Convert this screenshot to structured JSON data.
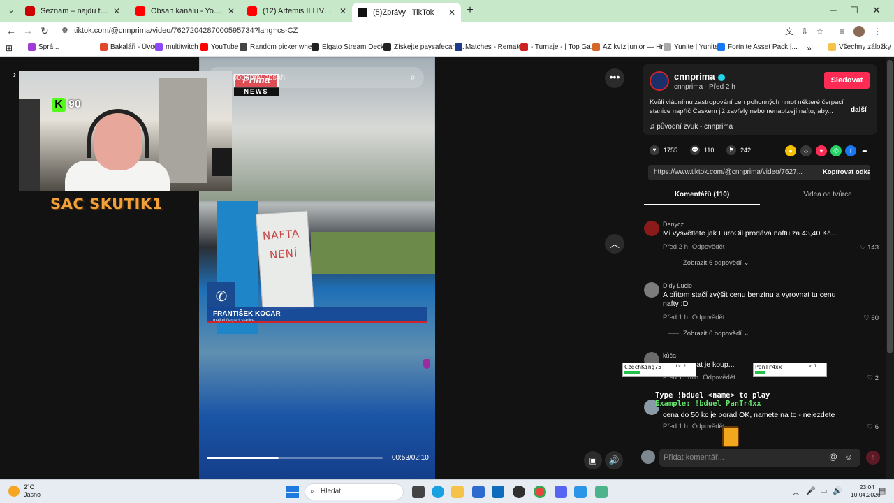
{
  "browser": {
    "tabs": [
      {
        "title": "Seznam – najdu tam, co neznám",
        "fav_color": "#cc0000"
      },
      {
        "title": "Obsah kanálu - YouTube Studio",
        "fav_color": "#ff0000"
      },
      {
        "title": "(12) Artemis II LIVE: Earth re...",
        "fav_color": "#ff0000"
      },
      {
        "title": "(5)Zprávy | TikTok",
        "fav_color": "#111111"
      }
    ],
    "new_tab": "+",
    "url": "tiktok.com/@cnnprima/video/7627204287000595734?lang=cs-CZ",
    "bookmarks": [
      {
        "label": "Sprá...",
        "color": "#a23bd6"
      },
      {
        "label": "Bakaláři - Úvod",
        "color": "#e04a2a"
      },
      {
        "label": "multitwitch",
        "color": "#9146ff"
      },
      {
        "label": "YouTube",
        "color": "#ff0000"
      },
      {
        "label": "Random picker whe...",
        "color": "#444444"
      },
      {
        "label": "Elgato Stream Deck...",
        "color": "#222222"
      },
      {
        "label": "Získejte paysafecard...",
        "color": "#222222"
      },
      {
        "label": "Matches - Rematch",
        "color": "#1d3a8a"
      },
      {
        "label": "- Turnaje - | Top Ga...",
        "color": "#cc2222"
      },
      {
        "label": "AZ kvíz junior — Hr...",
        "color": "#d4662a"
      },
      {
        "label": "Yunite | Yunite",
        "color": "#aaaaaa"
      },
      {
        "label": "Fortnite Asset Pack |...",
        "color": "#1877f2"
      }
    ],
    "all_bookmarks": "Všechny záložky"
  },
  "video": {
    "search_placeholder": "podobný obsah",
    "logo_top": "Prima",
    "logo_bottom": "NEWS",
    "sign_lines": [
      "NAFTA",
      "NENÍ"
    ],
    "lower_third_name": "FRANTIŠEK KOCAR",
    "lower_third_role": "majitel čerpací stanice",
    "time": "00:53/02:10",
    "progress": 0.41
  },
  "stream": {
    "kick_count": "90",
    "streamer_name": "SAC SKUTIK1"
  },
  "post": {
    "author": "cnnprima",
    "sub": "cnnprima · Před 2 h",
    "follow": "Sledovat",
    "description": "Kvůli vládnímu zastropování cen pohonných hmot některé čerpací stanice napříč Českem již zavřely nebo nenabízejí naftu, aby...",
    "more": "další",
    "sound": "♫  původní zvuk - cnnprima",
    "likes": "1755",
    "comments": "110",
    "saves": "242",
    "link": "https://www.tiktok.com/@cnnprima/video/7627...",
    "copy_link": "Kopírovat odkaz"
  },
  "tabs": {
    "comments": "Komentářů (110)",
    "creator_videos": "Videa od tvůrce"
  },
  "comments": [
    {
      "name": "Denycz",
      "text": "Mi vysvětlete jak EuroOil prodává naftu za 43,40 Kč...",
      "time": "Před 2 h",
      "reply": "Odpovědět",
      "likes": "143",
      "replies": "Zobrazit 6 odpovědí ⌄",
      "avatar": "#8b1a1a"
    },
    {
      "name": "Didy Lucie",
      "text": "A přitom stačí zvýšit cenu benzínu a vyrovnat tu cenu nafty :D",
      "time": "Před 1 h",
      "reply": "Odpovědět",
      "likes": "60",
      "replies": "Zobrazit 6 odpovědí ⌄",
      "avatar": "#7c7c7c"
    },
    {
      "name": "kůča",
      "text": "...pumpy.. at je koup...",
      "time": "Před 17 min",
      "reply": "Odpovědět",
      "likes": "2",
      "avatar": "#6b6b6b"
    },
    {
      "name": "",
      "text": "cena do 50 kc je porad OK, namete na to - nejezdete",
      "time": "Před 1 h",
      "reply": "Odpovědět",
      "likes": "6",
      "avatar": "#8a9aa6"
    }
  ],
  "compose": {
    "placeholder": "Přidat komentář..."
  },
  "overlay": {
    "player1": "CzechKing75",
    "player1_lv": "Lv.2",
    "player2": "PanTr4xx",
    "player2_lv": "Lv.1",
    "line1": "Type !bduel <name> to play",
    "line2": "Example: !bduel PanTr4xx"
  },
  "taskbar": {
    "temp": "2°C",
    "weather": "Jasno",
    "search": "Hledat",
    "time": "23:04",
    "date": "10.04.2026"
  }
}
